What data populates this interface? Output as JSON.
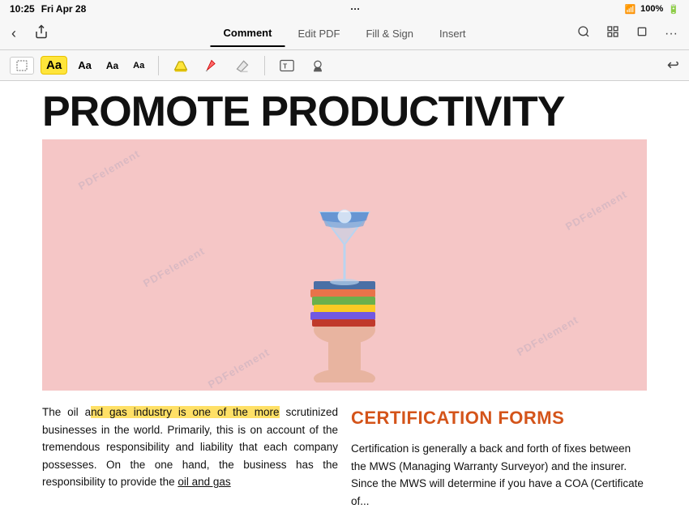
{
  "statusBar": {
    "time": "10:25",
    "day": "Fri Apr 28",
    "dots": "···",
    "wifi": "WiFi",
    "battery": "100%"
  },
  "toolbar": {
    "tabs": [
      {
        "id": "comment",
        "label": "Comment",
        "active": true
      },
      {
        "id": "editpdf",
        "label": "Edit PDF",
        "active": false
      },
      {
        "id": "fillsign",
        "label": "Fill & Sign",
        "active": false
      },
      {
        "id": "insert",
        "label": "Insert",
        "active": false
      }
    ]
  },
  "annotationToolbar": {
    "fontButtons": [
      "Aa",
      "Aa",
      "Aa",
      "Aa"
    ],
    "undoLabel": "↩"
  },
  "page": {
    "bigTitle": "PROMOTE PRODUCTIVITY",
    "watermarks": [
      "PDFelement",
      "PDFelement",
      "PDFelement",
      "PDFelement",
      "PDFelement"
    ],
    "leftText": "The oil and gas industry is one of the more scrutinized businesses in the world. Primarily, this is on account of the tremendous responsibility and liability that each company possesses. On the one hand, the business has the responsibility to provide the oil and gas",
    "leftTextHighlightStart": "nd gas industry is one of the more",
    "certTitle": "CERTIFICATION FORMS",
    "rightText": "Certification is generally a back and forth of fixes between the MWS (Managing Warranty Surveyor) and the insurer. Since the MWS will determine if you have a COA (Certificate of..."
  }
}
